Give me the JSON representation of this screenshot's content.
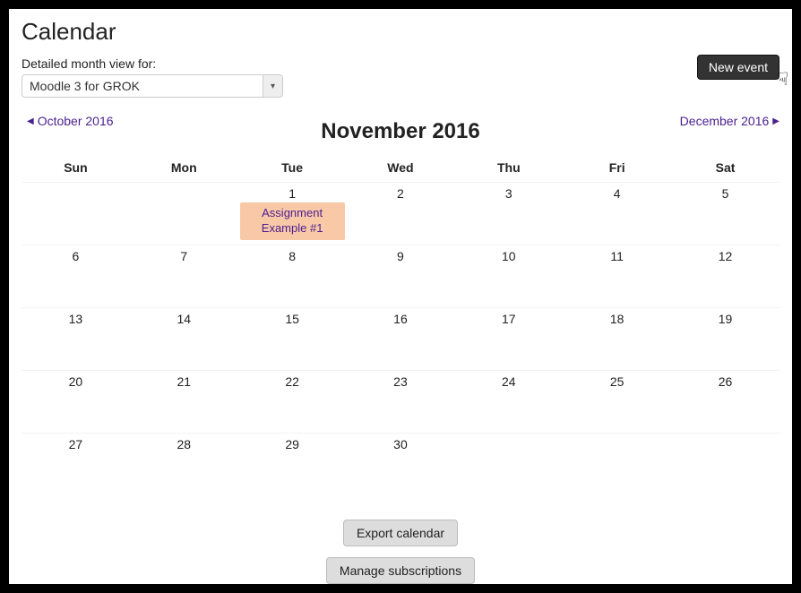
{
  "title": "Calendar",
  "selector": {
    "label": "Detailed month view for:",
    "value": "Moodle 3 for GROK"
  },
  "new_event_label": "New event",
  "nav": {
    "prev": "October 2016",
    "current": "November 2016",
    "next": "December 2016"
  },
  "weekdays": [
    "Sun",
    "Mon",
    "Tue",
    "Wed",
    "Thu",
    "Fri",
    "Sat"
  ],
  "weeks": [
    [
      {
        "day": ""
      },
      {
        "day": ""
      },
      {
        "day": "1",
        "event": "Assignment Example #1"
      },
      {
        "day": "2"
      },
      {
        "day": "3"
      },
      {
        "day": "4"
      },
      {
        "day": "5"
      }
    ],
    [
      {
        "day": "6"
      },
      {
        "day": "7"
      },
      {
        "day": "8"
      },
      {
        "day": "9"
      },
      {
        "day": "10"
      },
      {
        "day": "11"
      },
      {
        "day": "12"
      }
    ],
    [
      {
        "day": "13"
      },
      {
        "day": "14"
      },
      {
        "day": "15"
      },
      {
        "day": "16"
      },
      {
        "day": "17"
      },
      {
        "day": "18"
      },
      {
        "day": "19"
      }
    ],
    [
      {
        "day": "20"
      },
      {
        "day": "21"
      },
      {
        "day": "22"
      },
      {
        "day": "23"
      },
      {
        "day": "24"
      },
      {
        "day": "25"
      },
      {
        "day": "26"
      }
    ],
    [
      {
        "day": "27"
      },
      {
        "day": "28"
      },
      {
        "day": "29"
      },
      {
        "day": "30"
      },
      {
        "day": ""
      },
      {
        "day": ""
      },
      {
        "day": ""
      }
    ]
  ],
  "buttons": {
    "export": "Export calendar",
    "manage": "Manage subscriptions"
  }
}
